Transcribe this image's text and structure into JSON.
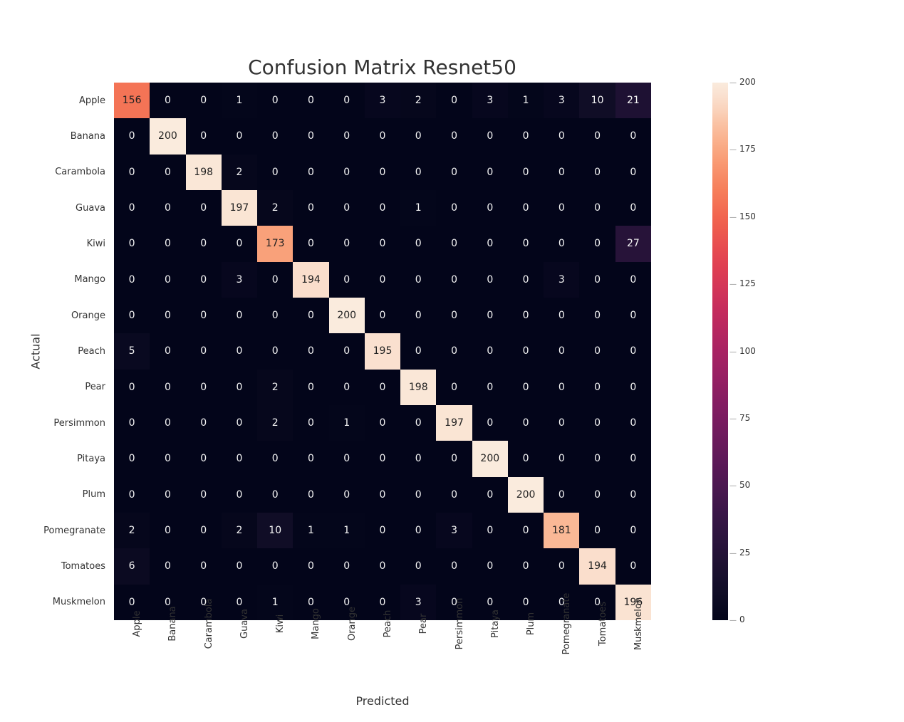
{
  "chart_data": {
    "type": "heatmap",
    "title": "Confusion Matrix Resnet50",
    "xlabel": "Predicted",
    "ylabel": "Actual",
    "categories": [
      "Apple",
      "Banana",
      "Carambola",
      "Guava",
      "Kiwi",
      "Mango",
      "Orange",
      "Peach",
      "Pear",
      "Persimmon",
      "Pitaya",
      "Plum",
      "Pomegranate",
      "Tomatoes",
      "Muskmelon"
    ],
    "values": [
      [
        156,
        0,
        0,
        1,
        0,
        0,
        0,
        3,
        2,
        0,
        3,
        1,
        3,
        10,
        21
      ],
      [
        0,
        200,
        0,
        0,
        0,
        0,
        0,
        0,
        0,
        0,
        0,
        0,
        0,
        0,
        0
      ],
      [
        0,
        0,
        198,
        2,
        0,
        0,
        0,
        0,
        0,
        0,
        0,
        0,
        0,
        0,
        0
      ],
      [
        0,
        0,
        0,
        197,
        2,
        0,
        0,
        0,
        1,
        0,
        0,
        0,
        0,
        0,
        0
      ],
      [
        0,
        0,
        0,
        0,
        173,
        0,
        0,
        0,
        0,
        0,
        0,
        0,
        0,
        0,
        27
      ],
      [
        0,
        0,
        0,
        3,
        0,
        194,
        0,
        0,
        0,
        0,
        0,
        0,
        3,
        0,
        0
      ],
      [
        0,
        0,
        0,
        0,
        0,
        0,
        200,
        0,
        0,
        0,
        0,
        0,
        0,
        0,
        0
      ],
      [
        5,
        0,
        0,
        0,
        0,
        0,
        0,
        195,
        0,
        0,
        0,
        0,
        0,
        0,
        0
      ],
      [
        0,
        0,
        0,
        0,
        2,
        0,
        0,
        0,
        198,
        0,
        0,
        0,
        0,
        0,
        0
      ],
      [
        0,
        0,
        0,
        0,
        2,
        0,
        1,
        0,
        0,
        197,
        0,
        0,
        0,
        0,
        0
      ],
      [
        0,
        0,
        0,
        0,
        0,
        0,
        0,
        0,
        0,
        0,
        200,
        0,
        0,
        0,
        0
      ],
      [
        0,
        0,
        0,
        0,
        0,
        0,
        0,
        0,
        0,
        0,
        0,
        200,
        0,
        0,
        0
      ],
      [
        2,
        0,
        0,
        2,
        10,
        1,
        1,
        0,
        0,
        3,
        0,
        0,
        181,
        0,
        0
      ],
      [
        6,
        0,
        0,
        0,
        0,
        0,
        0,
        0,
        0,
        0,
        0,
        0,
        0,
        194,
        0
      ],
      [
        0,
        0,
        0,
        0,
        1,
        0,
        0,
        0,
        3,
        0,
        0,
        0,
        0,
        0,
        196
      ]
    ],
    "vmin": 0,
    "vmax": 200,
    "colorbar_ticks": [
      0,
      25,
      50,
      75,
      100,
      125,
      150,
      175,
      200
    ],
    "cmap": "rocket"
  }
}
